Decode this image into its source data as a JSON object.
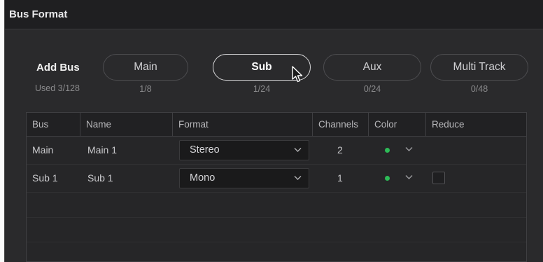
{
  "window": {
    "title": "Bus Format"
  },
  "add_bus": {
    "label": "Add Bus",
    "used": "Used 3/128",
    "buttons": [
      {
        "label": "Main",
        "count": "1/8",
        "selected": false
      },
      {
        "label": "Sub",
        "count": "1/24",
        "selected": true
      },
      {
        "label": "Aux",
        "count": "0/24",
        "selected": false
      },
      {
        "label": "Multi Track",
        "count": "0/48",
        "selected": false
      }
    ]
  },
  "table": {
    "columns": [
      "Bus",
      "Name",
      "Format",
      "Channels",
      "Color",
      "Reduce"
    ],
    "rows": [
      {
        "bus": "Main",
        "name": "Main 1",
        "format": "Stereo",
        "channels": "2",
        "color": "#2dbb57",
        "reduce_checkbox": false
      },
      {
        "bus": "Sub 1",
        "name": "Sub 1",
        "format": "Mono",
        "channels": "1",
        "color": "#2dbb57",
        "reduce_checkbox": true
      }
    ]
  },
  "icons": {
    "cursor": "pointer-cursor-icon",
    "dropdown": "chevron-down-icon",
    "color_dot": "color-dot-icon"
  }
}
